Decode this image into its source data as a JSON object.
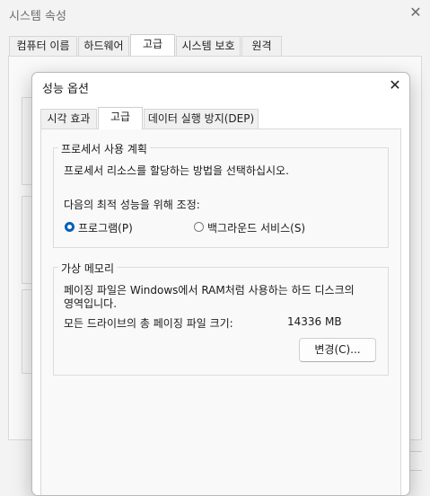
{
  "background_window": {
    "title": "시스템 속성",
    "tabs": [
      "컴퓨터 이름",
      "하드웨어",
      "고급",
      "시스템 보호",
      "원격"
    ],
    "active_tab": "고급"
  },
  "dialog": {
    "title": "성능 옵션",
    "tabs": [
      "시각 효과",
      "고급",
      "데이터 실행 방지(DEP)"
    ],
    "active_tab": "고급",
    "processor_group": {
      "legend": "프로세서 사용 계획",
      "description": "프로세서 리소스를 할당하는 방법을 선택하십시오.",
      "adjust_label": "다음의 최적 성능을 위해 조정:",
      "options": [
        {
          "label": "프로그램(P)",
          "selected": true
        },
        {
          "label": "백그라운드 서비스(S)",
          "selected": false
        }
      ]
    },
    "virtual_memory_group": {
      "legend": "가상 메모리",
      "description_line1": "페이징 파일은 Windows에서 RAM처럼 사용하는 하드 디스크의",
      "description_line2": "영역입니다.",
      "total_label": "모든 드라이브의 총 페이징 파일 크기:",
      "total_value": "14336 MB",
      "change_button": "변경(C)..."
    }
  },
  "colors": {
    "accent": "#005fb8",
    "window_bg": "#f3f3f3",
    "panel_bg": "#f9f9f9"
  }
}
